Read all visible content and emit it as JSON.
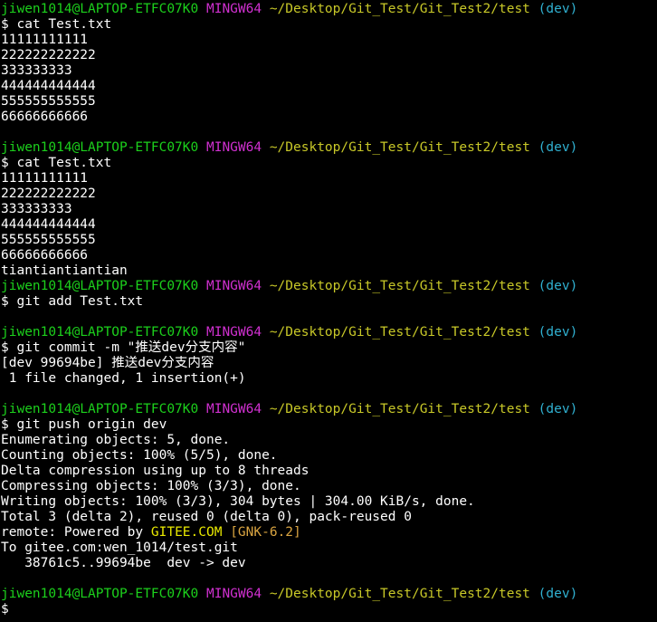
{
  "prompt": {
    "user_host": "jiwen1014@LAPTOP-ETFC07K0",
    "env": "MINGW64",
    "path": "~/Desktop/Git_Test/Git_Test2/test",
    "branch": "(dev)",
    "symbol": "$"
  },
  "colors": {
    "background": "#000000",
    "text": "#ffffff",
    "user_host": "#1cd01c",
    "env": "#d030d0",
    "path": "#c8c828",
    "branch": "#30b0d0",
    "gitee": "#e8e800",
    "gnk": "#d9a441"
  },
  "lines": [
    {
      "type": "prompt"
    },
    {
      "type": "cmd",
      "text": "cat Test.txt"
    },
    {
      "type": "out",
      "text": "11111111111"
    },
    {
      "type": "out",
      "text": "222222222222"
    },
    {
      "type": "out",
      "text": "333333333"
    },
    {
      "type": "out",
      "text": "444444444444"
    },
    {
      "type": "out",
      "text": "555555555555"
    },
    {
      "type": "out",
      "text": "66666666666"
    },
    {
      "type": "blank"
    },
    {
      "type": "prompt"
    },
    {
      "type": "cmd",
      "text": "cat Test.txt"
    },
    {
      "type": "out",
      "text": "11111111111"
    },
    {
      "type": "out",
      "text": "222222222222"
    },
    {
      "type": "out",
      "text": "333333333"
    },
    {
      "type": "out",
      "text": "444444444444"
    },
    {
      "type": "out",
      "text": "555555555555"
    },
    {
      "type": "out",
      "text": "66666666666"
    },
    {
      "type": "out",
      "text": "tiantiantiantian"
    },
    {
      "type": "prompt"
    },
    {
      "type": "cmd",
      "text": "git add Test.txt"
    },
    {
      "type": "blank"
    },
    {
      "type": "prompt"
    },
    {
      "type": "cmd",
      "text": "git commit -m \"推送dev分支内容\""
    },
    {
      "type": "out",
      "text": "[dev 99694be] 推送dev分支内容"
    },
    {
      "type": "out",
      "text": " 1 file changed, 1 insertion(+)"
    },
    {
      "type": "blank"
    },
    {
      "type": "prompt"
    },
    {
      "type": "cmd",
      "text": "git push origin dev"
    },
    {
      "type": "out",
      "text": "Enumerating objects: 5, done."
    },
    {
      "type": "out",
      "text": "Counting objects: 100% (5/5), done."
    },
    {
      "type": "out",
      "text": "Delta compression using up to 8 threads"
    },
    {
      "type": "out",
      "text": "Compressing objects: 100% (3/3), done."
    },
    {
      "type": "out",
      "text": "Writing objects: 100% (3/3), 304 bytes | 304.00 KiB/s, done."
    },
    {
      "type": "out",
      "text": "Total 3 (delta 2), reused 0 (delta 0), pack-reused 0"
    },
    {
      "type": "remote",
      "prefix": "remote: Powered by ",
      "gitee": "GITEE.COM",
      "gnk": "[GNK-6.2]"
    },
    {
      "type": "out",
      "text": "To gitee.com:wen_1014/test.git"
    },
    {
      "type": "out",
      "text": "   38761c5..99694be  dev -> dev"
    },
    {
      "type": "blank"
    },
    {
      "type": "prompt"
    },
    {
      "type": "input",
      "text": ""
    }
  ]
}
